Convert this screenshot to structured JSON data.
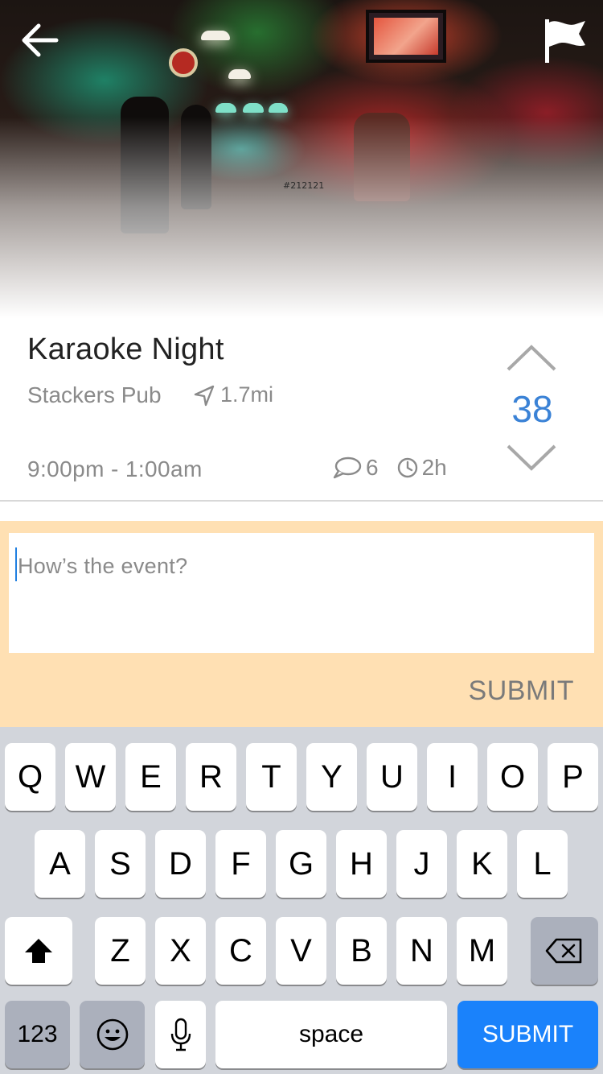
{
  "hero": {
    "tag": "#212121",
    "back_icon": "arrow-left-icon",
    "flag_icon": "flag-icon"
  },
  "event": {
    "title": "Karaoke Night",
    "venue": "Stackers Pub",
    "distance": "1.7mi",
    "time_range": "9:00pm - 1:00am",
    "comment_count": "6",
    "age": "2h",
    "votes": "38"
  },
  "comment": {
    "placeholder": "How’s the event?",
    "submit_label": "SUBMIT"
  },
  "keyboard": {
    "row1": [
      "Q",
      "W",
      "E",
      "R",
      "T",
      "Y",
      "U",
      "I",
      "O",
      "P"
    ],
    "row2": [
      "A",
      "S",
      "D",
      "F",
      "G",
      "H",
      "J",
      "K",
      "L"
    ],
    "row3": [
      "Z",
      "X",
      "C",
      "V",
      "B",
      "N",
      "M"
    ],
    "numbers_label": "123",
    "space_label": "space",
    "return_label": "SUBMIT"
  },
  "colors": {
    "accent": "#3a82d6",
    "comment_bg": "#ffe0b3",
    "keyboard_bg": "#d2d5db",
    "return_key": "#1a82fb"
  }
}
